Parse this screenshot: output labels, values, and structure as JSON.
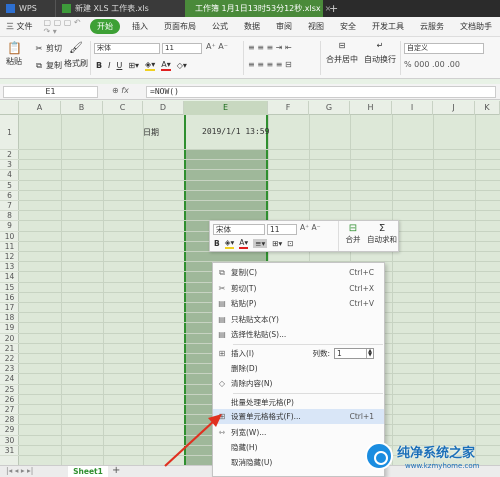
{
  "titlebar": {
    "tabs": [
      {
        "label": "WPS"
      },
      {
        "label": "新建 XLS 工作表.xls"
      },
      {
        "label": "工作簿 1月1日13时53分12秒.xlsx"
      }
    ]
  },
  "menubar": {
    "file": "三 文件",
    "items": [
      "开始",
      "插入",
      "页面布局",
      "公式",
      "数据",
      "审阅",
      "视图",
      "安全",
      "开发工具",
      "云服务",
      "文档助手"
    ]
  },
  "ribbon": {
    "paste": "粘贴",
    "cut": "剪切",
    "copy": "复制",
    "format_painter": "格式刷",
    "font_name": "宋体",
    "font_size": "11",
    "merge_center": "合并居中",
    "wrap": "自动换行",
    "number_format": "自定义",
    "percent_symbols": "% 000 .00 .00",
    "colors": {
      "accent": "#3da035"
    }
  },
  "formulabar": {
    "name_box": "E1",
    "formula": "=NOW()"
  },
  "grid": {
    "columns": [
      "A",
      "B",
      "C",
      "D",
      "E",
      "F",
      "G",
      "H",
      "I",
      "J",
      "K"
    ],
    "selected_column": "E",
    "rows": [
      "1",
      "2",
      "3",
      "4",
      "5",
      "6",
      "7",
      "8",
      "9",
      "10",
      "11",
      "12",
      "13",
      "14",
      "15",
      "16",
      "17",
      "18",
      "19",
      "20",
      "21",
      "22",
      "23",
      "24",
      "25",
      "26",
      "27",
      "28",
      "29",
      "30",
      "31"
    ],
    "d1": "日期",
    "e1": "2019/1/1 13:59"
  },
  "sheetbar": {
    "sheet_name": "Sheet1",
    "add": "+"
  },
  "minitoolbar": {
    "font_name": "宋体",
    "font_size": "11",
    "bold": "B",
    "merge": "合并",
    "autosum": "自动求和"
  },
  "context_menu": {
    "items": [
      {
        "icon": "copy-icon",
        "label": "复制(C)",
        "shortcut": "Ctrl+C"
      },
      {
        "icon": "cut-icon",
        "label": "剪切(T)",
        "shortcut": "Ctrl+X"
      },
      {
        "icon": "paste-icon",
        "label": "粘贴(P)",
        "shortcut": "Ctrl+V"
      },
      {
        "icon": "paste-text-icon",
        "label": "只粘贴文本(Y)",
        "shortcut": ""
      },
      {
        "icon": "paste-special-icon",
        "label": "选择性粘贴(S)...",
        "shortcut": ""
      },
      {
        "icon": "insert-icon",
        "label": "插入(I)",
        "shortcut": ""
      },
      {
        "icon": "",
        "label": "删除(D)",
        "shortcut": ""
      },
      {
        "icon": "clear-icon",
        "label": "清除内容(N)",
        "shortcut": ""
      },
      {
        "icon": "",
        "label": "批量处理单元格(P)",
        "shortcut": ""
      },
      {
        "icon": "format-cells-icon",
        "label": "设置单元格格式(F)...",
        "shortcut": "Ctrl+1"
      },
      {
        "icon": "column-width-icon",
        "label": "列宽(W)...",
        "shortcut": ""
      },
      {
        "icon": "",
        "label": "隐藏(H)",
        "shortcut": ""
      },
      {
        "icon": "",
        "label": "取消隐藏(U)",
        "shortcut": ""
      }
    ],
    "column_count_label": "列数:",
    "column_count_value": "1"
  },
  "watermark": {
    "title": "纯净系统之家",
    "url": "www.kzmyhome.com"
  }
}
